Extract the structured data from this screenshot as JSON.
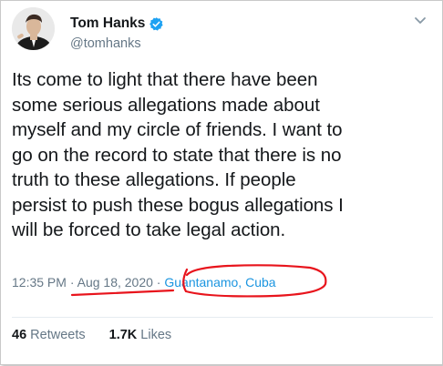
{
  "tweet": {
    "author_name": "Tom Hanks",
    "author_handle": "@tomhanks",
    "text_lines": [
      "Its come to light that there have been",
      "some serious allegations made about",
      "myself and my circle of friends. I want to",
      "go on the record to state that there is no",
      "truth to these allegations. If people",
      "persist to push these bogus allegations I",
      "will be forced to take legal action."
    ],
    "time": "12:35 PM",
    "separator": " · ",
    "date": "Aug 18, 2020",
    "location": "Guantanamo, Cuba",
    "retweets_count": "46",
    "retweets_label": "Retweets",
    "likes_count": "1.7K",
    "likes_label": "Likes"
  },
  "icons": {
    "verified": "verified-badge-icon",
    "menu": "chevron-down-icon"
  },
  "colors": {
    "text": "#14171a",
    "secondary": "#657786",
    "link": "#1b95e0",
    "verified": "#1da1f2",
    "annotation": "#e8141c"
  }
}
